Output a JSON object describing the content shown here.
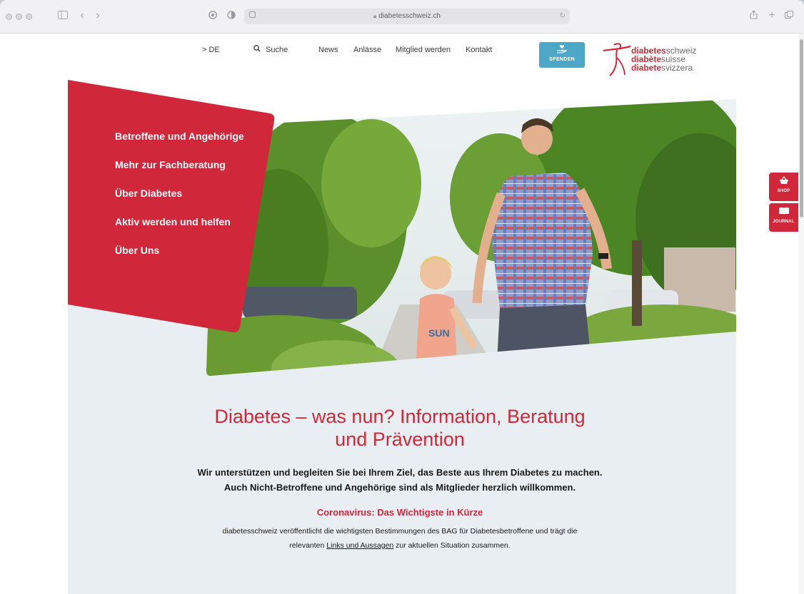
{
  "browser": {
    "url": "diabetesschweiz.ch",
    "icons": {
      "sidebar": "sidebar-icon",
      "back": "back-icon",
      "forward": "forward-icon",
      "privacy": "privacy-icon",
      "theme": "half-circle-icon",
      "tab": "tab-icon",
      "lock": "lock-icon",
      "reload": "reload-icon",
      "share": "share-icon",
      "new_tab": "plus-icon",
      "tabs_overview": "tabs-icon"
    }
  },
  "topnav": {
    "language": "> DE",
    "search": "Suche",
    "items": [
      "News",
      "Anlässe",
      "Mitglied werden",
      "Kontakt"
    ],
    "donate_label": "SPENDEN"
  },
  "logo": {
    "lines": [
      {
        "bold": "diabetes",
        "rest": "schweiz"
      },
      {
        "bold": "diabète",
        "rest": "suisse"
      },
      {
        "bold": "diabete",
        "rest": "svizzera"
      }
    ]
  },
  "main_menu": {
    "items": [
      "Betroffene und Angehörige",
      "Mehr zur Fachberatung",
      "Über Diabetes",
      "Aktiv werden und helfen",
      "Über Uns"
    ]
  },
  "side_buttons": {
    "shop": "SHOP",
    "journal": "JOURNAL"
  },
  "content": {
    "headline_line1": "Diabetes – was nun? Information, Beratung",
    "headline_line2": "und Prävention",
    "intro_line1": "Wir unterstützen und begleiten Sie bei Ihrem Ziel, das Beste aus Ihrem Diabetes zu machen.",
    "intro_line2": "Auch Nicht-Betroffene und Angehörige sind als Mitglieder herzlich willkommen.",
    "corona_title": "Coronavirus: Das Wichtigste in Kürze",
    "corona_line1": "diabetesschweiz veröffentlicht die wichtigsten Bestimmungen des BAG für Diabetesbetroffene und trägt die",
    "corona_line2_pre": "relevanten ",
    "corona_link": "Links und Aussagen",
    "corona_line2_post": " zur aktuellen Situation zusammen."
  },
  "colors": {
    "brand_red": "#d0283a",
    "donate_blue": "#4da7c7",
    "hero_bg": "#e8eef1"
  }
}
